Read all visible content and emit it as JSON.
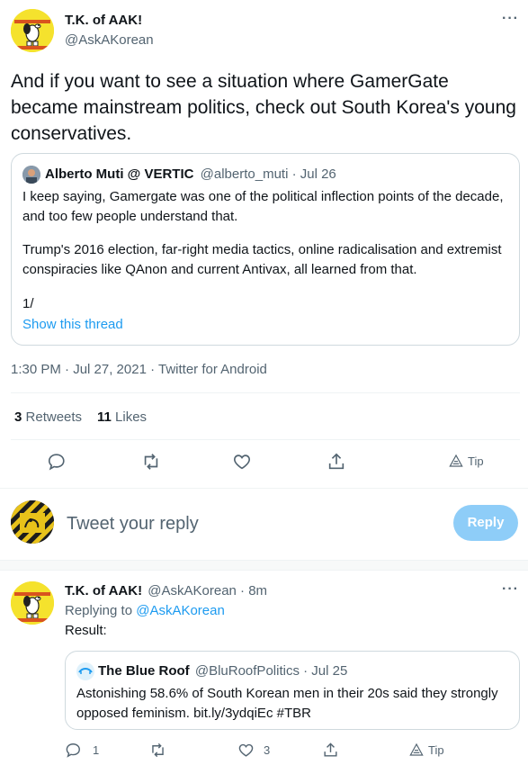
{
  "main_tweet": {
    "author_name": "T.K. of AAK!",
    "handle": "@AskAKorean",
    "text": "And if you want to see a situation where GamerGate became mainstream politics, check out South Korea's young conservatives.",
    "timestamp": "1:30 PM · Jul 27, 2021 · Twitter for Android",
    "retweets_count": "3",
    "retweets_label": "Retweets",
    "likes_count": "11",
    "likes_label": "Likes",
    "tip_label": "Tip"
  },
  "quoted_tweet": {
    "author_name": "Alberto Muti @ VERTIC",
    "handle_date": "@alberto_muti · Jul 26",
    "paragraph1": "I keep saying, Gamergate was one of the political inflection points of the decade, and too few people understand that.",
    "paragraph2": "Trump's 2016 election, far-right media tactics, online radicalisation and extremist conspiracies like QAnon and current Antivax, all learned from that.",
    "paragraph3": "1/",
    "show_thread": "Show this thread"
  },
  "reply_composer": {
    "placeholder": "Tweet your reply",
    "reply_button": "Reply"
  },
  "reply_tweet": {
    "author_name": "T.K. of AAK!",
    "handle_time": "@AskAKorean · 8m",
    "replying_to_prefix": "Replying to ",
    "replying_to_handle": "@AskAKorean",
    "text": "Result:",
    "reply_count": "1",
    "like_count": "3",
    "tip_label": "Tip"
  },
  "reply_quote": {
    "author_name": "The Blue Roof",
    "handle_date": "@BluRoofPolitics · Jul 25",
    "text": "Astonishing 58.6% of South Korean men in their 20s said they strongly opposed feminism. bit.ly/3ydqiEc #TBR"
  },
  "colors": {
    "accent": "#1d9bf0",
    "reply_button_disabled": "#8ecdf8",
    "avatar_yellow": "#f5e22d"
  }
}
